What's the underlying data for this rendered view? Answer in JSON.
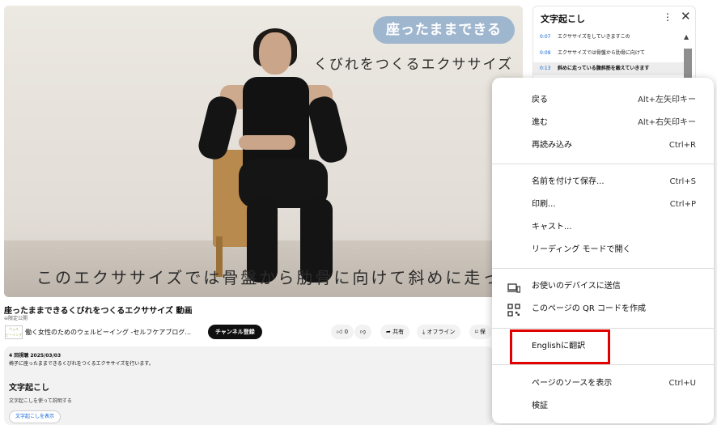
{
  "video": {
    "overlay_pill": "座ったままできる",
    "overlay_title": "くびれをつくるエクササイズ",
    "caption": "このエクササイズでは骨盤から肋骨に向けて斜めに走っている"
  },
  "transcript_panel": {
    "title": "文字起こし",
    "rows": [
      {
        "time": "0:07",
        "text": "エクササイズをしていきますこの"
      },
      {
        "time": "0:09",
        "text": "エクササイズでは骨盤から肋骨に向けて"
      },
      {
        "time": "0:13",
        "text": "斜めに走っている腹斜筋を鍛えていきます"
      }
    ]
  },
  "info": {
    "title": "座ったままできるくびれをつくるエクササイズ 動画",
    "badge": "限定公開",
    "channel_name": "働く女性のためのウェルビーイング -セルフケアブログ...",
    "subscribe": "チャンネル登録",
    "like_count": "0",
    "share": "共有",
    "offline": "オフライン",
    "save": "保"
  },
  "description": {
    "meta": "4 回視聴  2025/03/03",
    "text": "椅子に座ったままできるくびれをつくるエクササイズを行います。",
    "section_title": "文字起こし",
    "section_text": "文字起こしを使って説明する",
    "button": "文字起こしを表示"
  },
  "context_menu": {
    "back": {
      "label": "戻る",
      "shortcut": "Alt+左矢印キー"
    },
    "forward": {
      "label": "進む",
      "shortcut": "Alt+右矢印キー"
    },
    "reload": {
      "label": "再読み込み",
      "shortcut": "Ctrl+R"
    },
    "save_as": {
      "label": "名前を付けて保存...",
      "shortcut": "Ctrl+S"
    },
    "print": {
      "label": "印刷...",
      "shortcut": "Ctrl+P"
    },
    "cast": {
      "label": "キャスト..."
    },
    "reading_mode": {
      "label": "リーディング モードで開く"
    },
    "send_to_devices": {
      "label": "お使いのデバイスに送信"
    },
    "qr_code": {
      "label": "このページの QR コードを作成"
    },
    "translate": {
      "label": "Englishに翻訳"
    },
    "view_source": {
      "label": "ページのソースを表示",
      "shortcut": "Ctrl+U"
    },
    "inspect": {
      "label": "検証"
    }
  },
  "colors": {
    "highlight": "#e00000",
    "link": "#065fd4",
    "pill": "#9fb6cf"
  }
}
